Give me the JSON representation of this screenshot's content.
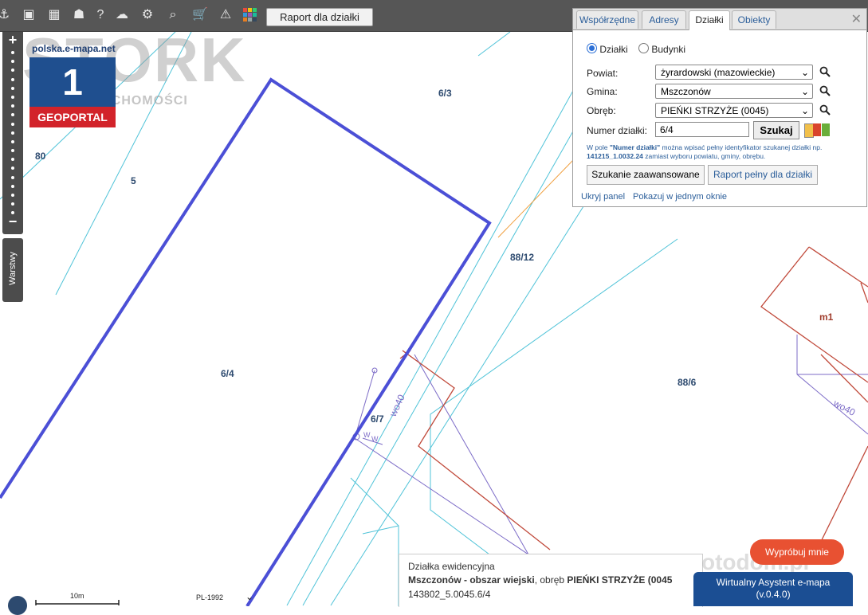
{
  "toolbar": {
    "raport_label": "Raport dla działki"
  },
  "branding": {
    "site_url": "polska.e-mapa.net",
    "logo_number": "1",
    "logo_text": "GEOPORTAL",
    "watermark": "STORK",
    "watermark_sub": "NIERUCHOMOŚCI"
  },
  "sidebar": {
    "layers_label": "Warstwy"
  },
  "map": {
    "parcel_labels": [
      "6/3",
      "80",
      "5",
      "88/12",
      "m1",
      "6/4",
      "88/6",
      "6/7",
      "wo40",
      "wo40",
      "W",
      "W"
    ]
  },
  "panel": {
    "tabs": [
      {
        "label": "Współrzędne"
      },
      {
        "label": "Adresy"
      },
      {
        "label": "Działki"
      },
      {
        "label": "Obiekty"
      }
    ],
    "radio_dzialki": "Działki",
    "radio_budynki": "Budynki",
    "powiat_label": "Powiat:",
    "powiat_value": "żyrardowski (mazowieckie)",
    "gmina_label": "Gmina:",
    "gmina_value": "Mszczonów",
    "obreb_label": "Obręb:",
    "obreb_value": "PIEŃKI STRZYŻE (0045)",
    "numer_label": "Numer działki:",
    "numer_value": "6/4",
    "szukaj_label": "Szukaj",
    "hint_part1": "W pole ",
    "hint_bold1": "\"Numer działki\"",
    "hint_part2": " można wpisać pełny identyfikator szukanej działki np. ",
    "hint_bold2": "141215_1.0032.24",
    "hint_part3": " zamiast wyboru powiatu, gminy, obrębu.",
    "advanced_label": "Szukanie zaawansowane",
    "full_report_label": "Raport pełny dla działki",
    "hide_panel": "Ukryj panel",
    "show_one_window": "Pokazuj w jednym oknie",
    "colors": [
      "#f2c04a",
      "#d9442c",
      "#6aae3a"
    ]
  },
  "info": {
    "title": "Działka ewidencyjna",
    "location_bold": "Mszczonów - obszar wiejski",
    "location_mid": ", obręb ",
    "location_bold2": "PIEŃKI STRZYŻE (0045",
    "identifier": "143802_5.0045.6/4"
  },
  "promo": {
    "try_label": "Wypróbuj mnie",
    "assistant_line1": "Wirtualny Asystent e-mapa",
    "assistant_line2": "(v.0.4.0)",
    "watermark": "otodom.pl"
  },
  "status": {
    "scale": "10m",
    "projection": "PL-1992"
  }
}
